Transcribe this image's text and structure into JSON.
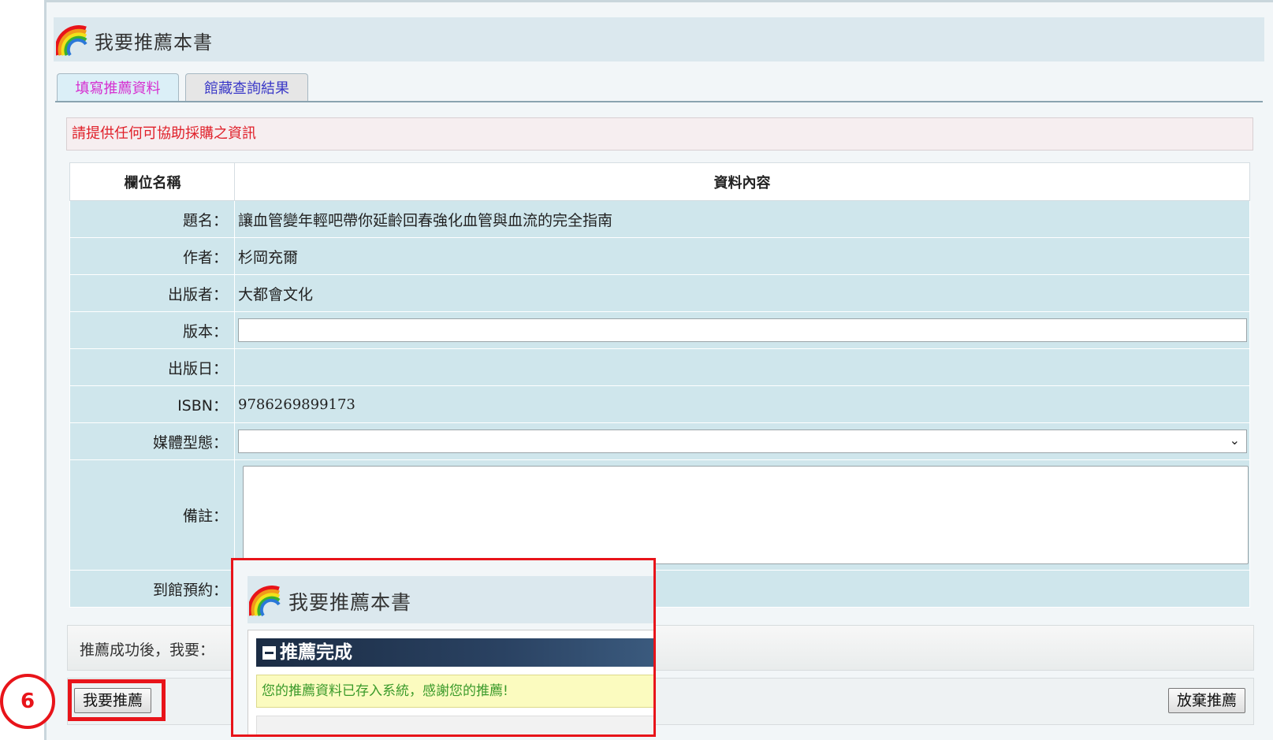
{
  "app": {
    "title": "我要推薦本書"
  },
  "tabs": [
    {
      "label": "填寫推薦資料",
      "active": true
    },
    {
      "label": "館藏查詢結果",
      "active": false
    }
  ],
  "notice": "請提供任何可協助採購之資訊",
  "table": {
    "headers": [
      "欄位名稱",
      "資料內容"
    ],
    "rows": [
      {
        "label": "題名：",
        "value": "讓血管變年輕吧帶你延齡回春強化血管與血流的完全指南"
      },
      {
        "label": "作者：",
        "value": "杉岡充爾"
      },
      {
        "label": "出版者：",
        "value": "大都會文化"
      },
      {
        "label": "版本：",
        "value": ""
      },
      {
        "label": "出版日：",
        "value": ""
      },
      {
        "label": "ISBN：",
        "value": "9786269899173"
      },
      {
        "label": "媒體型態：",
        "value": ""
      },
      {
        "label": "備註：",
        "value": ""
      },
      {
        "label": "到館預約：",
        "value": ""
      }
    ]
  },
  "after_success_label": "推薦成功後，我要：",
  "buttons": {
    "recommend": "我要推薦",
    "abandon": "放棄推薦"
  },
  "step_marker": "6",
  "popup": {
    "title": "我要推薦本書",
    "section_title": "推薦完成",
    "message": "您的推薦資料已存入系統，感謝您的推薦!"
  },
  "colors": {
    "accent_red": "#e8141a",
    "notice_red": "#e0202a",
    "row_bg": "#cfe6ec",
    "success_green": "#3a9a2a"
  }
}
